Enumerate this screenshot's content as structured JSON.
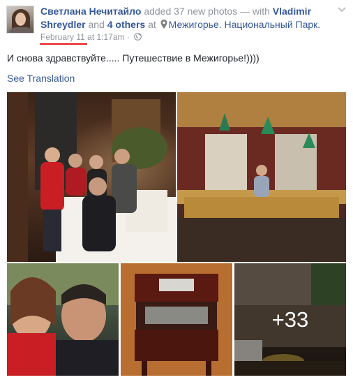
{
  "post": {
    "author": "Светлана Нечитайло",
    "action": "added 37 new photos — with",
    "tagged_person": "Vladimir Shreydler",
    "and_word": "and",
    "others": "4 others",
    "at_word": "at",
    "place": "Межигорье. Национальный Парк.",
    "date": "February 11",
    "time": "at 1:17am",
    "separator": "·",
    "text": "И снова здравствуйте..... Путешествие в Межигорье!))))",
    "see_translation": "See Translation",
    "more_photos": "+33",
    "icons": [
      "location-pin-icon",
      "globe-icon",
      "chevron-down-icon"
    ],
    "colors": {
      "link": "#365899",
      "meta": "#90949c",
      "annotation": "#e31b1b"
    }
  }
}
